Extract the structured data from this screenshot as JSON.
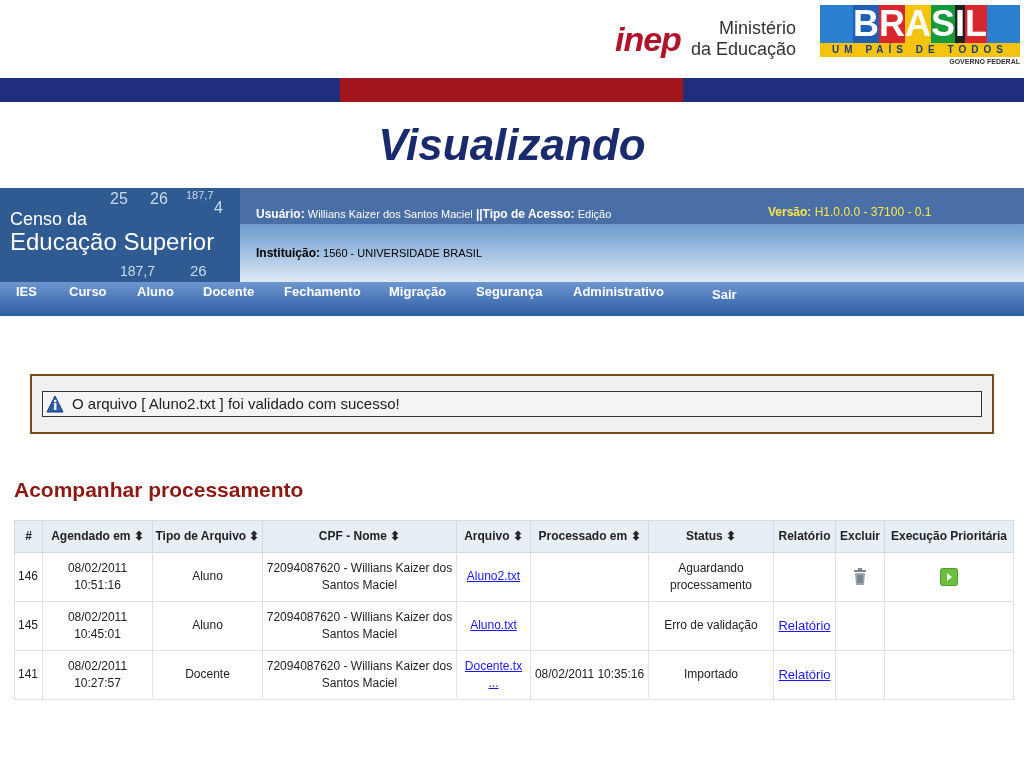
{
  "slide_header": {
    "inep_logo": "inep",
    "ministry": [
      "Ministério",
      "da Educação"
    ],
    "brasil_logo": {
      "word": "BRASIL",
      "slogan": "UM PAÍS DE TODOS",
      "sub": "GOVERNO FEDERAL"
    }
  },
  "slide_title": "Visualizando",
  "app": {
    "brand": [
      "Censo da",
      "Educação Superior"
    ],
    "banner_numbers": [
      "25",
      "26",
      "187,7",
      "4",
      "187,7",
      "26"
    ],
    "user_label": "Usuário:",
    "user": "Willians Kaizer dos Santos Maciel",
    "access_label": "||Tipo de Acesso:",
    "access": "Edição",
    "institution_label": "Instituição:",
    "institution": "1560 - UNIVERSIDADE BRASIL",
    "version_label": "Versão:",
    "version": "H1.0.0.0 - 37100 - 0.1",
    "menu": [
      "IES",
      "Curso",
      "Aluno",
      "Docente",
      "Fechamento",
      "Migração",
      "Segurança",
      "Administrativo",
      "Sair"
    ],
    "message": "O arquivo [ Aluno2.txt ] foi validado com sucesso!",
    "section_title": "Acompanhar processamento",
    "table": {
      "columns": [
        "#",
        "Agendado em ⬍",
        "Tipo de Arquivo ⬍",
        "CPF - Nome ⬍",
        "Arquivo ⬍",
        "Processado em ⬍",
        "Status ⬍",
        "Relatório",
        "Excluir",
        "Execução Prioritária"
      ],
      "rows": [
        {
          "id": "146",
          "scheduled": [
            "08/02/2011",
            "10:51:16"
          ],
          "type": "Aluno",
          "cpf_name": "72094087620 - Willians Kaizer dos Santos Maciel",
          "file": "Aluno2.txt",
          "status": "Aguardando processamento",
          "deletable": true,
          "priority": true
        },
        {
          "id": "145",
          "scheduled": [
            "08/02/2011",
            "10:45:01"
          ],
          "type": "Aluno",
          "cpf_name": "72094087620 - Willians Kaizer dos Santos Maciel",
          "file": "Aluno.txt",
          "status": "Erro de validação",
          "report": "Relatório",
          "deletable": false,
          "priority": false
        },
        {
          "id": "141",
          "scheduled": [
            "08/02/2011",
            "10:27:57"
          ],
          "type": "Docente",
          "cpf_name": "72094087620 - Willians Kaizer dos Santos Maciel",
          "file": "Docente.tx ...",
          "processed": "08/02/2011 10:35:16",
          "status": "Importado",
          "report": "Relatório",
          "deletable": false,
          "priority": false
        }
      ]
    }
  }
}
